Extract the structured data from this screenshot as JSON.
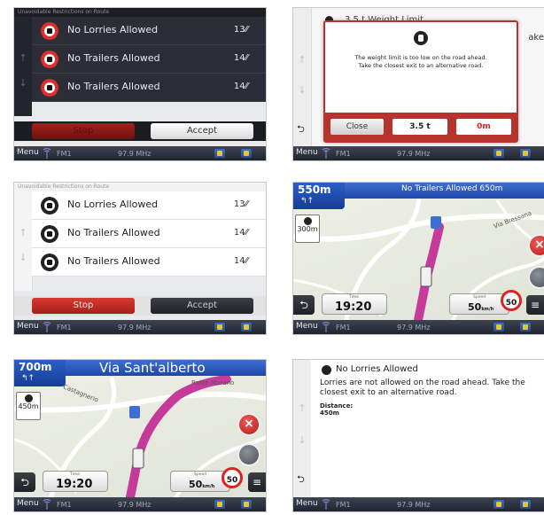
{
  "status_bar": {
    "menu": "Menu",
    "band": "FM1",
    "freq": "97.9 MHz"
  },
  "restrictions_screen": {
    "header": "Unavoidable Restrictions on Route",
    "rows": [
      {
        "label": "No Lorries Allowed",
        "value": "13⁄⁄"
      },
      {
        "label": "No Trailers Allowed",
        "value": "14⁄⁄"
      },
      {
        "label": "No Trailers Allowed",
        "value": "14⁄⁄"
      }
    ],
    "stop": "Stop",
    "accept": "Accept"
  },
  "weight_dialog": {
    "bg_title": "3.5 t Weight Limit",
    "bg_right": "ake",
    "message": "The weight limit is too low on the road ahead. Take the closest exit to an alternative road.",
    "close": "Close",
    "weight": "3.5 t",
    "zero": "0m"
  },
  "map_screen_1": {
    "distance": "550m",
    "arrows": "↰↑",
    "banner": "No Trailers Allowed 650m",
    "side_dist": "300m",
    "road_label": "Via Bressana",
    "time_label": "Time",
    "time": "19:20",
    "speed_label": "Speed",
    "speed": "50",
    "speed_unit": "km/h",
    "limit": "50"
  },
  "map_screen_2": {
    "distance": "700m",
    "arrows": "↰↑",
    "street": "Via Sant'alberto",
    "side_dist": "450m",
    "road_label_1": "Castagnerio",
    "road_label_2": "Ponte Murano",
    "time_label": "Time",
    "time": "19:20",
    "speed_label": "Speed",
    "speed": "50",
    "speed_unit": "km/h",
    "limit": "50"
  },
  "info_screen": {
    "title": "No Lorries Allowed",
    "description": "Lorries are not allowed on the road ahead. Take the closest exit to an alternative road.",
    "distance_label": "Distance:",
    "distance_value": "450m"
  },
  "colors": {
    "stop_red": "#d83a32",
    "dialog_red": "#b7332d",
    "route_magenta": "#c53a9b",
    "top_blue": "#1f48a8"
  }
}
